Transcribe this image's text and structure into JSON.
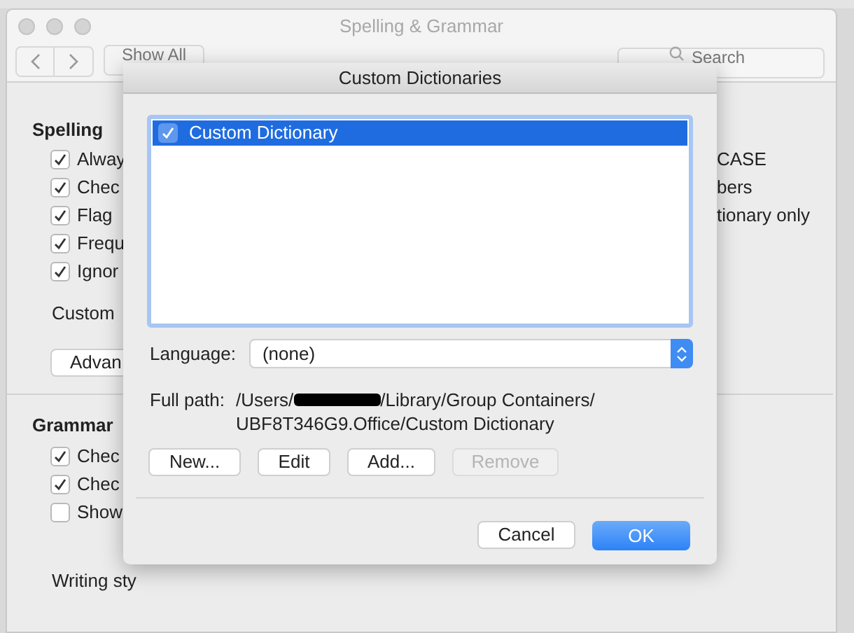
{
  "window": {
    "title": "Spelling & Grammar",
    "show_all": "Show All",
    "search": {
      "placeholder": "Search"
    }
  },
  "spelling": {
    "heading": "Spelling",
    "options": [
      {
        "label": "Alway",
        "checked": true
      },
      {
        "label": "Chec",
        "checked": true
      },
      {
        "label": "Flag",
        "checked": true
      },
      {
        "label": "Frequ",
        "checked": true
      },
      {
        "label": "Ignor",
        "checked": true
      }
    ],
    "right_options": [
      "CASE",
      "bers",
      "tionary only"
    ],
    "custom_label": "Custom",
    "advanced_button": "Advan"
  },
  "grammar": {
    "heading": "Grammar",
    "options": [
      {
        "label": "Chec",
        "checked": true
      },
      {
        "label": "Chec",
        "checked": true
      },
      {
        "label": "Show",
        "checked": false
      }
    ],
    "writing_style_label": "Writing sty"
  },
  "dialog": {
    "title": "Custom Dictionaries",
    "dictionaries": [
      {
        "label": "Custom Dictionary",
        "checked": true,
        "selected": true
      }
    ],
    "language": {
      "label": "Language:",
      "value": "(none)"
    },
    "full_path": {
      "label": "Full path:",
      "line_1_start": "/Users/",
      "line_1_end": "/Library/Group Containers/",
      "line_2": "UBF8T346G9.Office/Custom Dictionary"
    },
    "buttons": [
      {
        "label": "New...",
        "disabled": false
      },
      {
        "label": "Edit",
        "disabled": false
      },
      {
        "label": "Add...",
        "disabled": false
      },
      {
        "label": "Remove",
        "disabled": true
      }
    ],
    "cancel": "Cancel",
    "ok": "OK"
  }
}
